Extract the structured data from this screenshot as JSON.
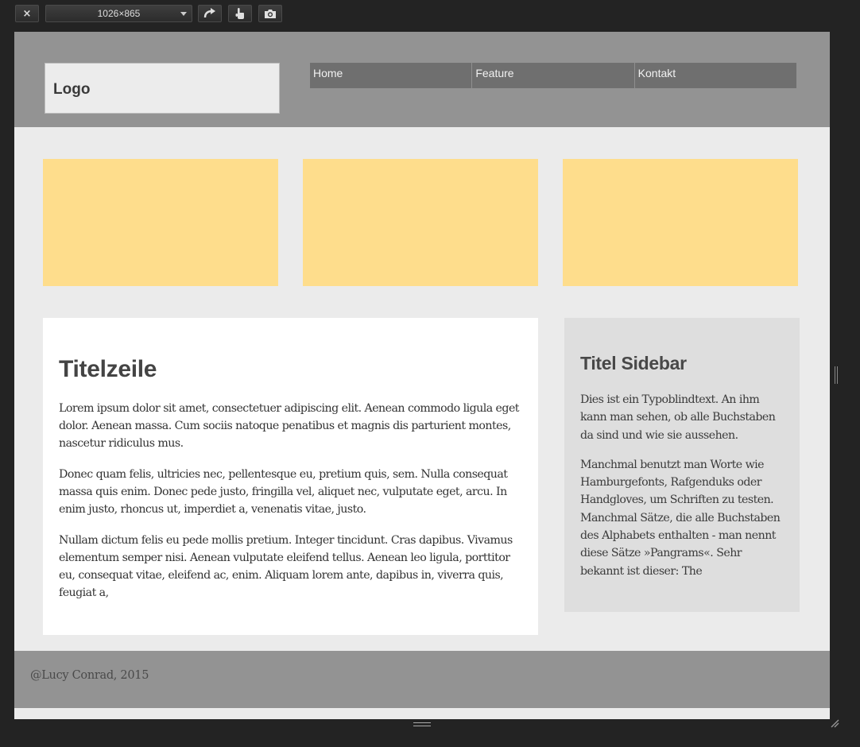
{
  "toolbar": {
    "close_glyph": "×",
    "size_label": "1026×865"
  },
  "site": {
    "logo": "Logo",
    "nav": [
      {
        "label": "Home"
      },
      {
        "label": "Feature"
      },
      {
        "label": "Kontakt"
      }
    ],
    "main": {
      "title": "Titelzeile",
      "paragraphs": [
        "Lorem ipsum dolor sit amet, consectetuer adipiscing elit. Aenean commodo ligula eget dolor. Aenean massa. Cum sociis natoque penatibus et magnis dis parturient montes, nascetur ridiculus mus.",
        "Donec quam felis, ultricies nec, pellentesque eu, pretium quis, sem. Nulla consequat massa quis enim. Donec pede justo, fringilla vel, aliquet nec, vulputate eget, arcu. In enim justo, rhoncus ut, imperdiet a, venenatis vitae, justo.",
        "Nullam dictum felis eu pede mollis pretium. Integer tincidunt. Cras dapibus. Vivamus elementum semper nisi. Aenean vulputate eleifend tellus. Aenean leo ligula, porttitor eu, consequat vitae, eleifend ac, enim. Aliquam lorem ante, dapibus in, viverra quis, feugiat a,"
      ]
    },
    "sidebar": {
      "title": "Titel Sidebar",
      "paragraphs": [
        "Dies ist ein Typoblindtext. An ihm kann man sehen, ob alle Buchstaben da sind und wie sie aussehen.",
        "Manchmal benutzt man Worte wie Hamburgefonts, Rafgenduks oder Handgloves, um Schriften zu testen. Manchmal Sätze, die alle Buchstaben des Alphabets enthalten - man nennt diese Sätze »Pangrams«. Sehr bekannt ist dieser: The"
      ]
    },
    "footer": "@Lucy Conrad, 2015"
  },
  "colors": {
    "header_bg": "#939393",
    "nav_bg": "#6f6f6f",
    "teaser_bg": "#fedd8c",
    "page_bg": "#ebebeb",
    "sidebar_bg": "#dedede",
    "chrome_bg": "#232323"
  },
  "icons": {
    "close": "close-icon",
    "size_dropdown": "chevron-down-icon",
    "rotate": "rotate-icon",
    "touch": "touch-hand-icon",
    "screenshot": "camera-icon"
  }
}
